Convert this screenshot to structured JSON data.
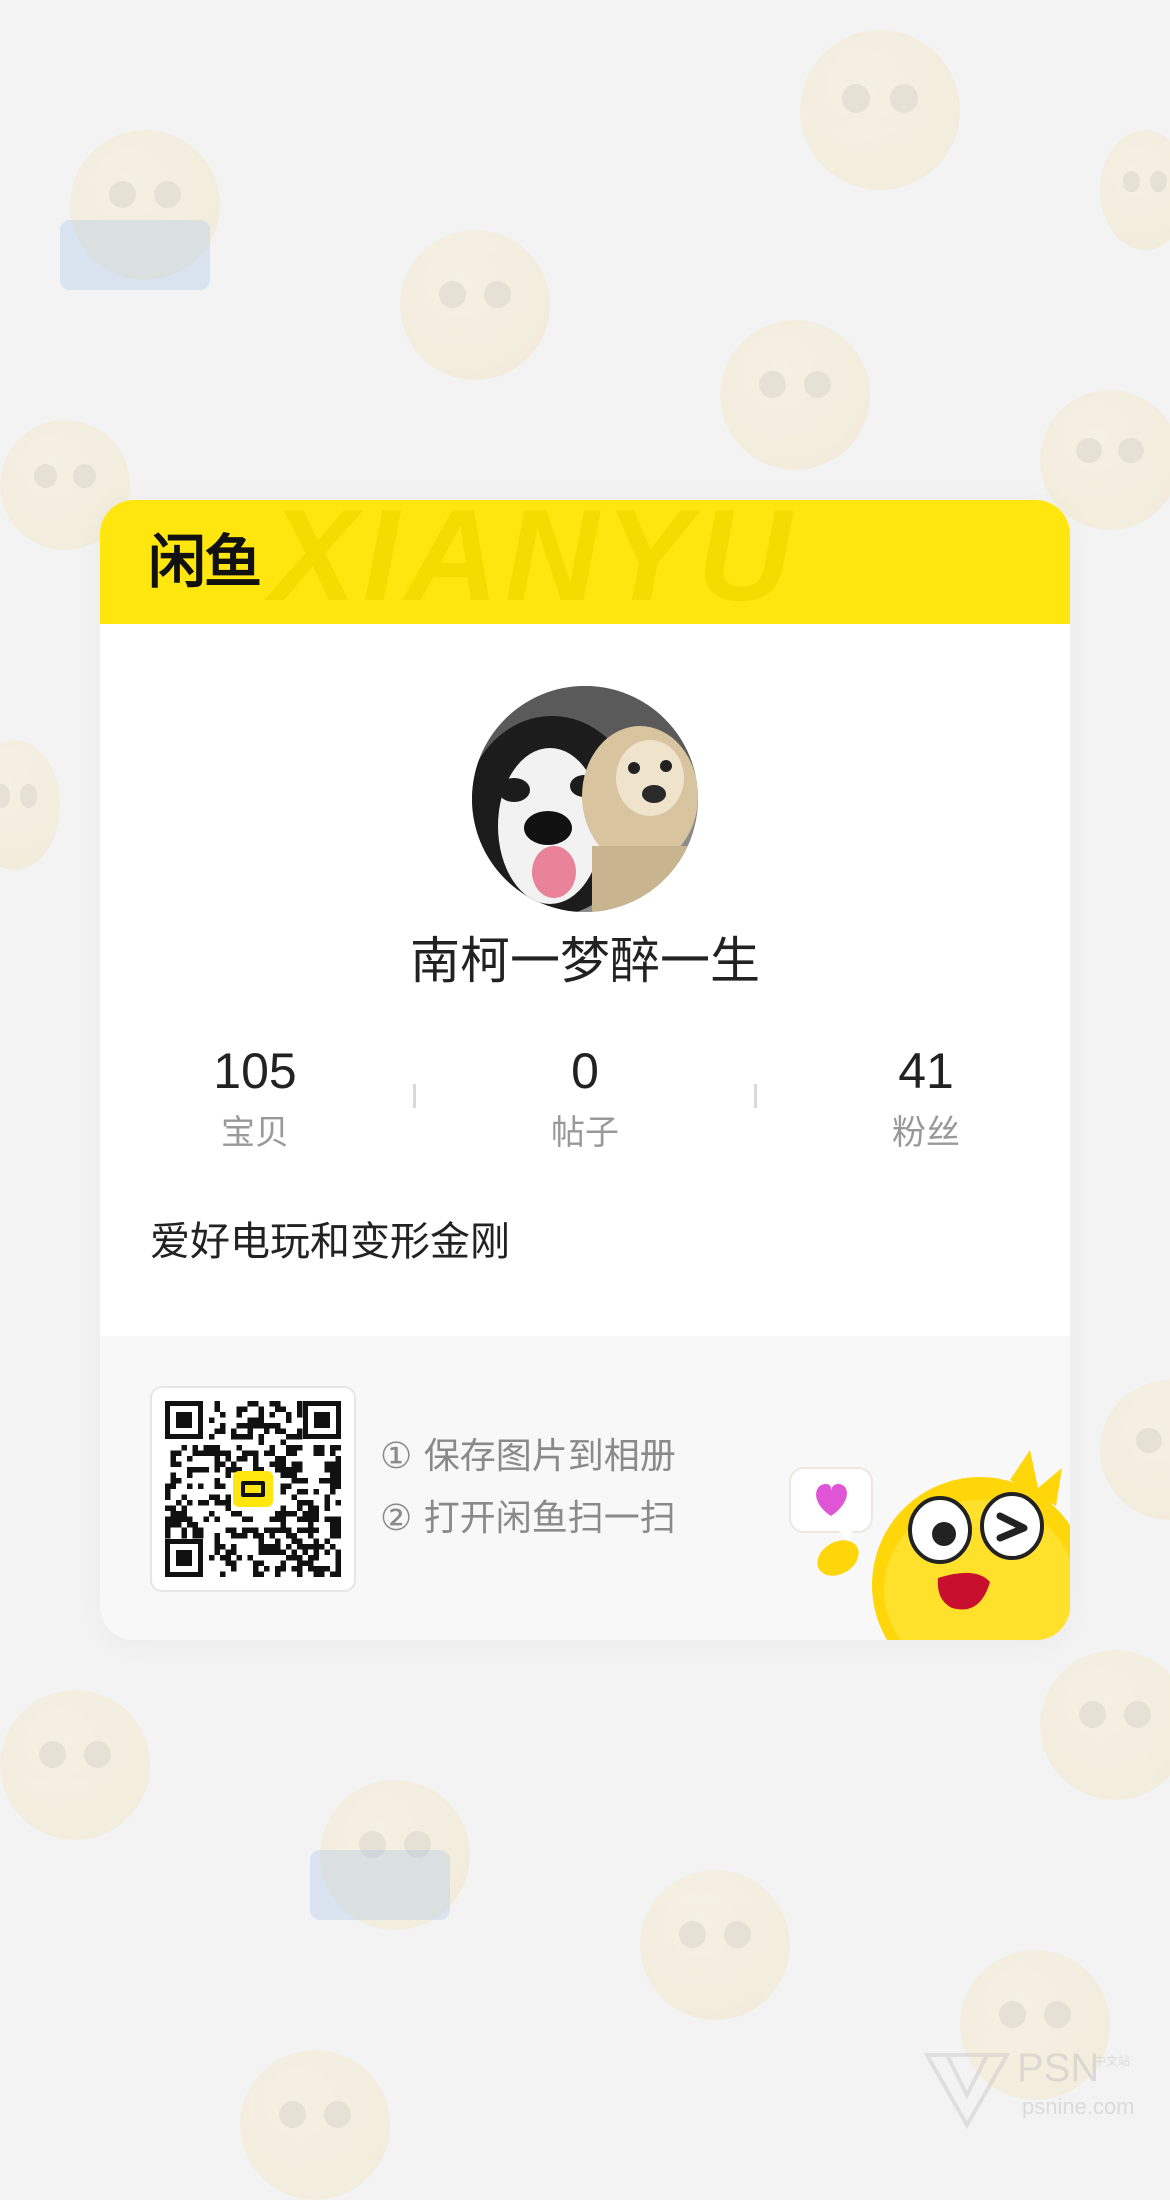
{
  "brand": {
    "logo_text": "闲鱼",
    "watermark_text": "XIANYU",
    "primary_color": "#ffe60f"
  },
  "profile": {
    "username": "南柯一梦醉一生",
    "bio": "爱好电玩和变形金刚",
    "avatar_icon": "dogs-photo-avatar"
  },
  "stats": [
    {
      "value": "105",
      "label": "宝贝"
    },
    {
      "value": "0",
      "label": "帖子"
    },
    {
      "value": "41",
      "label": "粉丝"
    }
  ],
  "footer": {
    "qr_icon": "qr-code",
    "steps": [
      "① 保存图片到相册",
      "② 打开闲鱼扫一扫"
    ],
    "mascot_icon": "yellow-fish-mascot-with-heart"
  },
  "watermark": {
    "name": "PSN",
    "sub": "中文站",
    "url": "psnine.com"
  }
}
